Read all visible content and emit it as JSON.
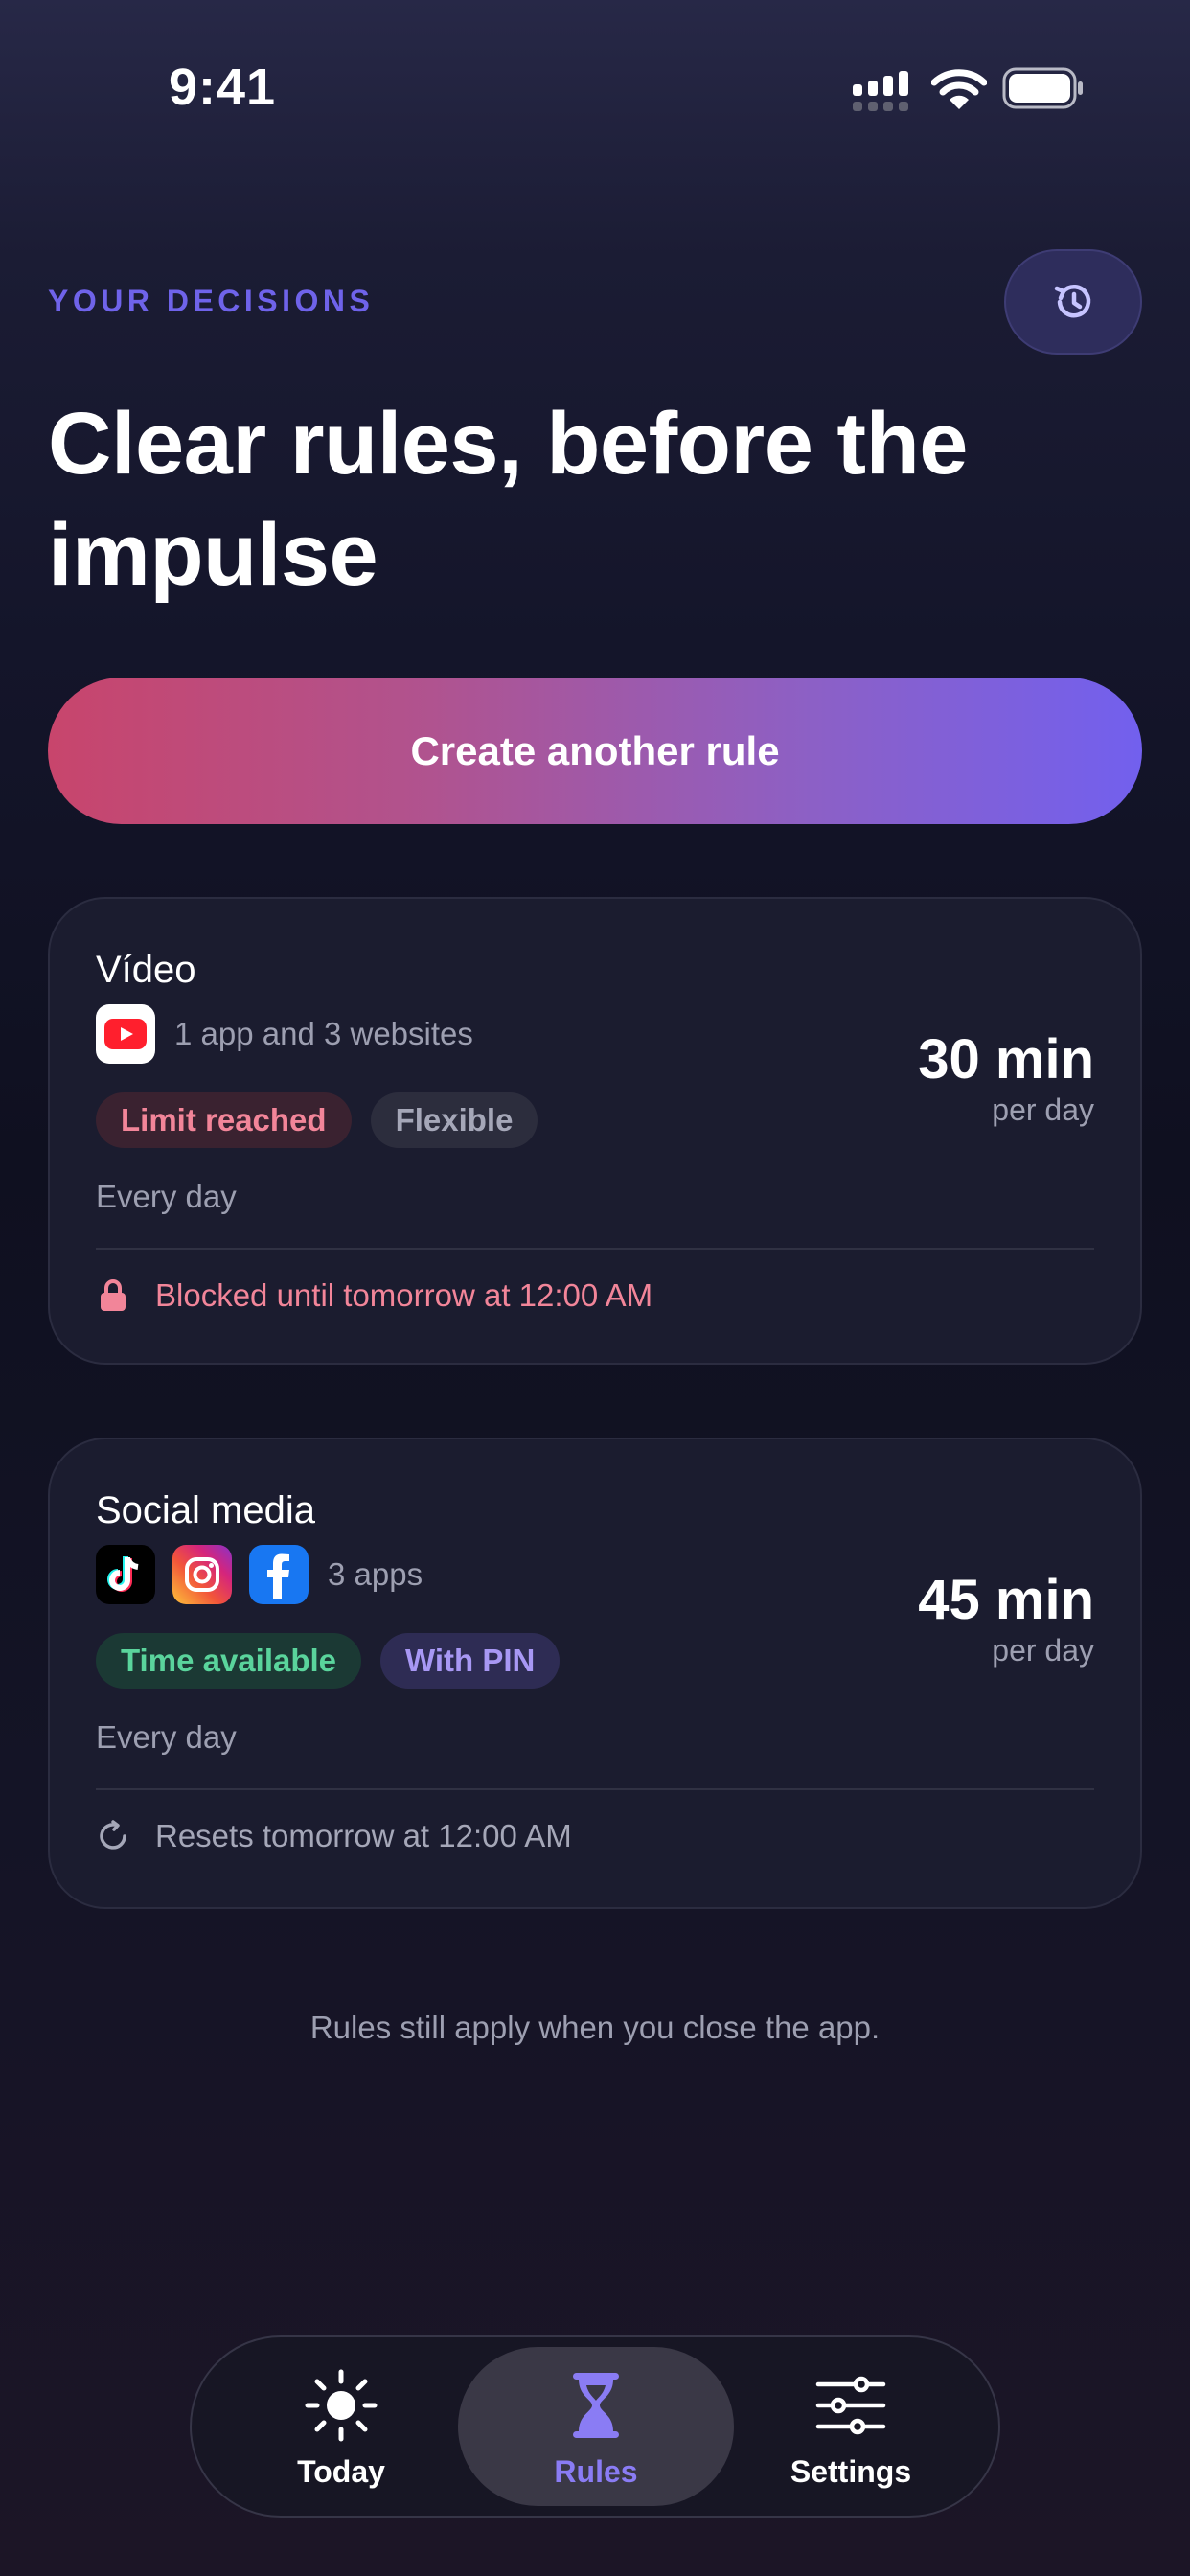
{
  "status_bar": {
    "time": "9:41"
  },
  "header": {
    "eyebrow": "YOUR DECISIONS",
    "title": "Clear rules, before the impulse",
    "history_icon": "history-icon"
  },
  "create_button": {
    "label": "Create another rule"
  },
  "rules": [
    {
      "name": "Vídeo",
      "apps": [
        "youtube-icon"
      ],
      "apps_summary": "1 app and 3 websites",
      "limit_value": "30 min",
      "limit_unit": "per day",
      "badges": [
        "Limit reached",
        "Flexible"
      ],
      "schedule": "Every day",
      "footer_icon": "lock-icon",
      "footer_text": "Blocked until tomorrow at 12:00 AM"
    },
    {
      "name": "Social media",
      "apps": [
        "tiktok-icon",
        "instagram-icon",
        "facebook-icon"
      ],
      "apps_summary": "3 apps",
      "limit_value": "45 min",
      "limit_unit": "per day",
      "badges": [
        "Time available",
        "With PIN"
      ],
      "schedule": "Every day",
      "footer_icon": "reset-icon",
      "footer_text": "Resets tomorrow at 12:00 AM"
    }
  ],
  "footnote": "Rules still apply when you close the app.",
  "tab_bar": {
    "active": "Rules",
    "tabs": [
      {
        "label": "Today",
        "icon": "sun-icon"
      },
      {
        "label": "Rules",
        "icon": "hourglass-icon"
      },
      {
        "label": "Settings",
        "icon": "sliders-icon"
      }
    ]
  },
  "colors": {
    "accent": "#7260ee",
    "eyebrow": "#6f63ea",
    "danger": "#f28599",
    "success": "#5ad49c",
    "card_bg": "#1b1c2f"
  }
}
